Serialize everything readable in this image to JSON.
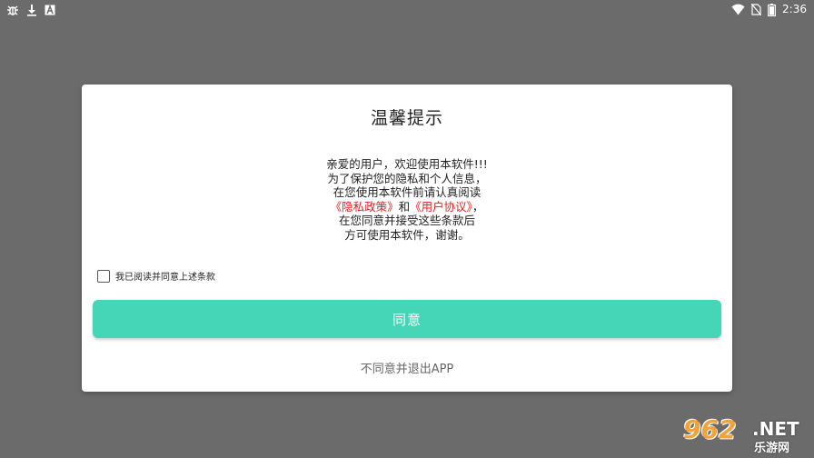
{
  "statusbar": {
    "time": "2:36",
    "left_icons": [
      "bug-icon",
      "download-icon",
      "a-badge-icon"
    ],
    "right_icons": [
      "wifi-icon",
      "no-sim-icon",
      "battery-icon"
    ]
  },
  "dialog": {
    "title": "温馨提示",
    "body": {
      "line1": "亲爱的用户，欢迎使用本软件!!!",
      "line2": "为了保护您的隐私和个人信息，",
      "line3": "在您使用本软件前请认真阅读",
      "privacy_link": "《隐私政策》",
      "and": "和",
      "user_link": "《用户协议》",
      "comma": "，",
      "line5": "在您同意并接受这些条款后",
      "line6": "方可使用本软件，谢谢。"
    },
    "checkbox_label": "我已阅读并同意上述条款",
    "checkbox_checked": false,
    "agree_button": "同意",
    "decline_button": "不同意并退出APP"
  },
  "watermark": {
    "number": "962",
    "suffix": ".NET",
    "sub": "乐游网"
  },
  "colors": {
    "accent": "#44d6b6",
    "link": "#e02020",
    "overlay": "#6b6b6b"
  }
}
